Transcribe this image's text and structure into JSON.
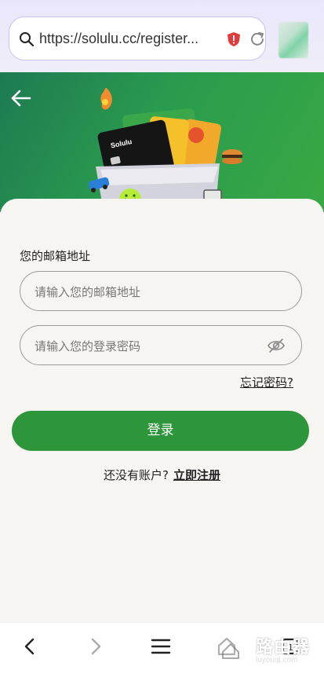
{
  "browser": {
    "url": "https://solulu.cc/register...",
    "icons": [
      "search-icon",
      "security-shield-icon",
      "reload-icon"
    ]
  },
  "hero": {
    "brand": "Solulu",
    "accent": "#2e963a"
  },
  "form": {
    "email_label": "您的邮箱地址",
    "email_placeholder": "请输入您的邮箱地址",
    "password_placeholder": "请输入您的登录密码",
    "forgot_link": "忘记密码?",
    "login_button": "登录",
    "no_account_text": "还没有账户?",
    "signup_link": "立即注册"
  },
  "bottom_nav": {
    "items": [
      "back-icon",
      "forward-icon",
      "menu-icon",
      "home-icon",
      "tabs-icon"
    ],
    "tabs_count": "1"
  },
  "watermark": {
    "text": "路由器",
    "sub": "luyouqi.com"
  }
}
